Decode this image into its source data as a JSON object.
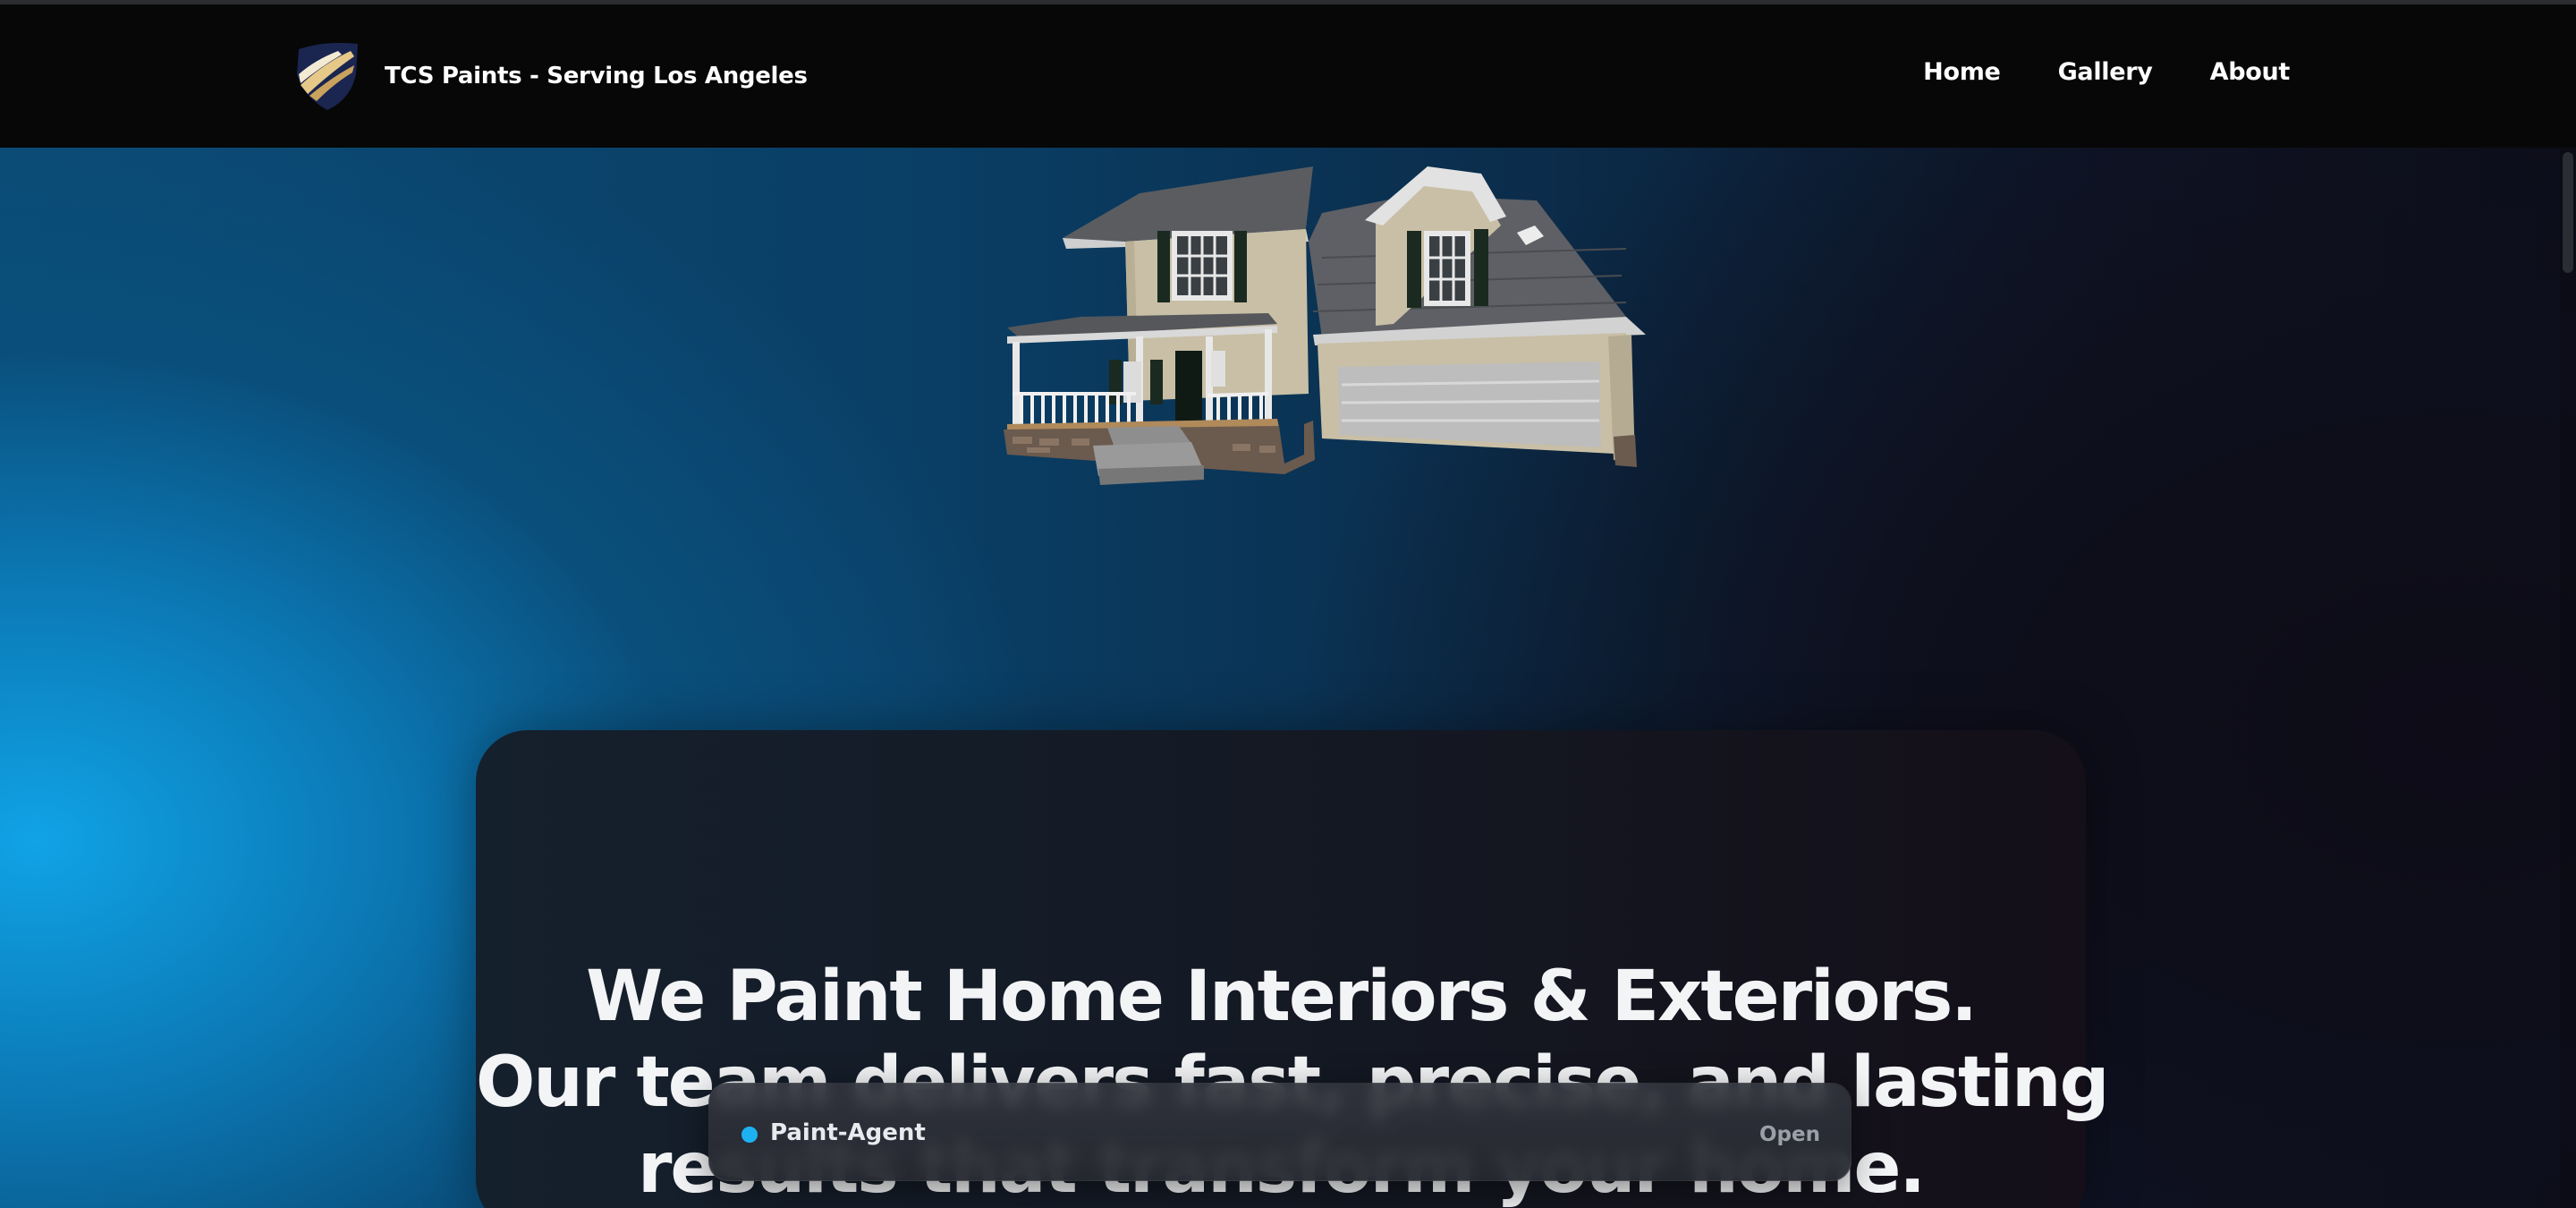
{
  "navbar": {
    "brand_name": "TCS Paints - Serving Los Angeles",
    "logo_icon": "shield-logo-icon",
    "links": [
      {
        "label": "Home"
      },
      {
        "label": "Gallery"
      },
      {
        "label": "About"
      }
    ]
  },
  "hero": {
    "image_icon": "house-3d-model",
    "headline_lines": [
      "We Paint Home Interiors & Exteriors.",
      "Our team delivers fast, precise, and lasting",
      "results that transform your home."
    ]
  },
  "agent": {
    "name": "Paint-Agent",
    "open_label": "Open",
    "status_color": "#1cb2f2"
  },
  "colors": {
    "navbar_bg": "#070707",
    "accent_blue": "#10a3e6",
    "logo_navy": "#1a2550",
    "logo_gold": "#d9b56c"
  }
}
